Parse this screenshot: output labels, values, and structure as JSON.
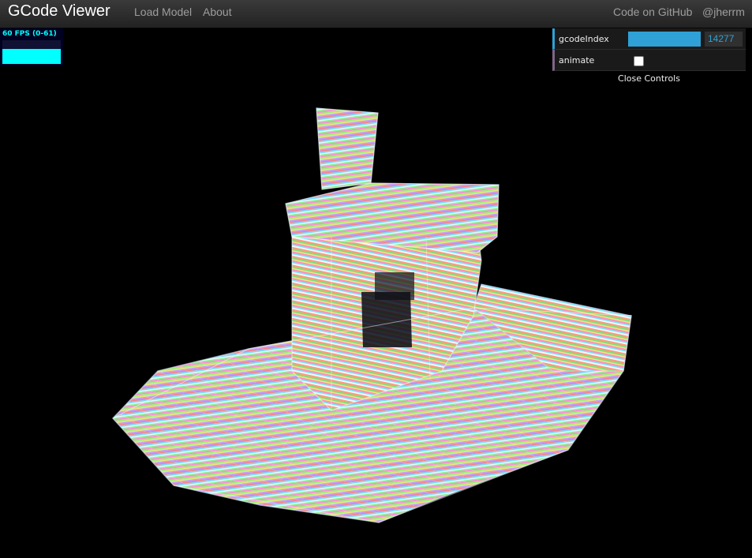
{
  "navbar": {
    "brand": "GCode Viewer",
    "links": {
      "load_model": "Load Model",
      "about": "About",
      "github": "Code on GitHub",
      "user": "@jherrm"
    }
  },
  "stats": {
    "fps_text": "60 FPS (0-61)",
    "graph_level": 0.62,
    "color": "#00ffff"
  },
  "controls": {
    "gcode_index": {
      "label": "gcodeIndex",
      "value": "14277",
      "slider_fraction": 1.0
    },
    "animate": {
      "label": "animate",
      "checked": false
    },
    "close_label": "Close Controls"
  },
  "colors": {
    "navbar": "#2c2c2c",
    "accent_number": "#2fa1d6",
    "accent_bool": "#806787",
    "background": "#000000"
  },
  "viewport": {
    "object": "benchy-boat-gcode-model"
  }
}
